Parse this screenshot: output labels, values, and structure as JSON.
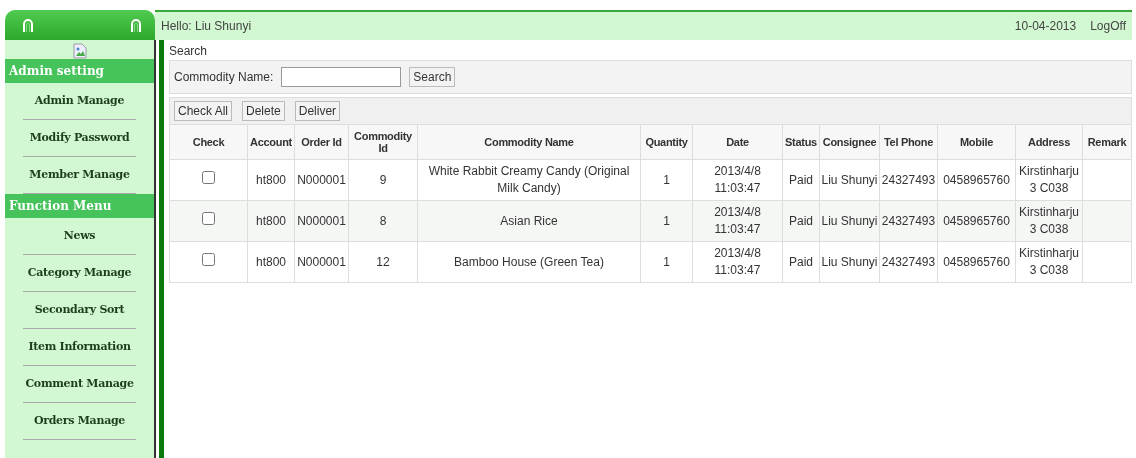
{
  "header": {
    "greeting": "Hello: Liu Shunyi",
    "date": "10-04-2013",
    "logoff": "LogOff"
  },
  "sidebar": {
    "sections": [
      {
        "title": "Admin setting",
        "items": [
          "Admin Manage",
          "Modify Password",
          "Member Manage"
        ]
      },
      {
        "title": "Function Menu",
        "items": [
          "News",
          "Category Manage",
          "Secondary Sort",
          "Item Information",
          "Comment Manage",
          "Orders Manage"
        ]
      }
    ]
  },
  "search": {
    "title": "Search",
    "label": "Commodity Name:",
    "button": "Search"
  },
  "toolbar": [
    "Check All",
    "Delete",
    "Deliver"
  ],
  "table": {
    "columns": [
      "Check",
      "Account",
      "Order Id",
      "Commodity Id",
      "Commodity Name",
      "Quantity",
      "Date",
      "Status",
      "Consignee",
      "Tel Phone",
      "Mobile",
      "Address",
      "Remark"
    ],
    "rows": [
      {
        "cells": [
          {
            "kind": "checkbox",
            "checked": false
          },
          "ht800",
          "N000001",
          "9",
          "White Rabbit Creamy Candy (Original Milk Candy)",
          "1",
          "2013/4/8 11:03:47",
          "Paid",
          "Liu Shunyi",
          "24327493",
          "0458965760",
          "Kirstinharju 3 C038"
        ]
      },
      {
        "cells": [
          {
            "kind": "checkbox",
            "checked": false
          },
          "ht800",
          "N000001",
          "8",
          "Asian Rice",
          "1",
          "2013/4/8 11:03:47",
          "Paid",
          "Liu Shunyi",
          "24327493",
          "0458965760",
          "Kirstinharju 3 C038"
        ]
      },
      {
        "cells": [
          {
            "kind": "checkbox",
            "checked": false
          },
          "ht800",
          "N000001",
          "12",
          "Bamboo House (Green Tea)",
          "1",
          "2013/4/8 11:03:47",
          "Paid",
          "Liu Shunyi",
          "24327493",
          "0458965760",
          "Kirstinharju 3 C038"
        ]
      }
    ]
  }
}
